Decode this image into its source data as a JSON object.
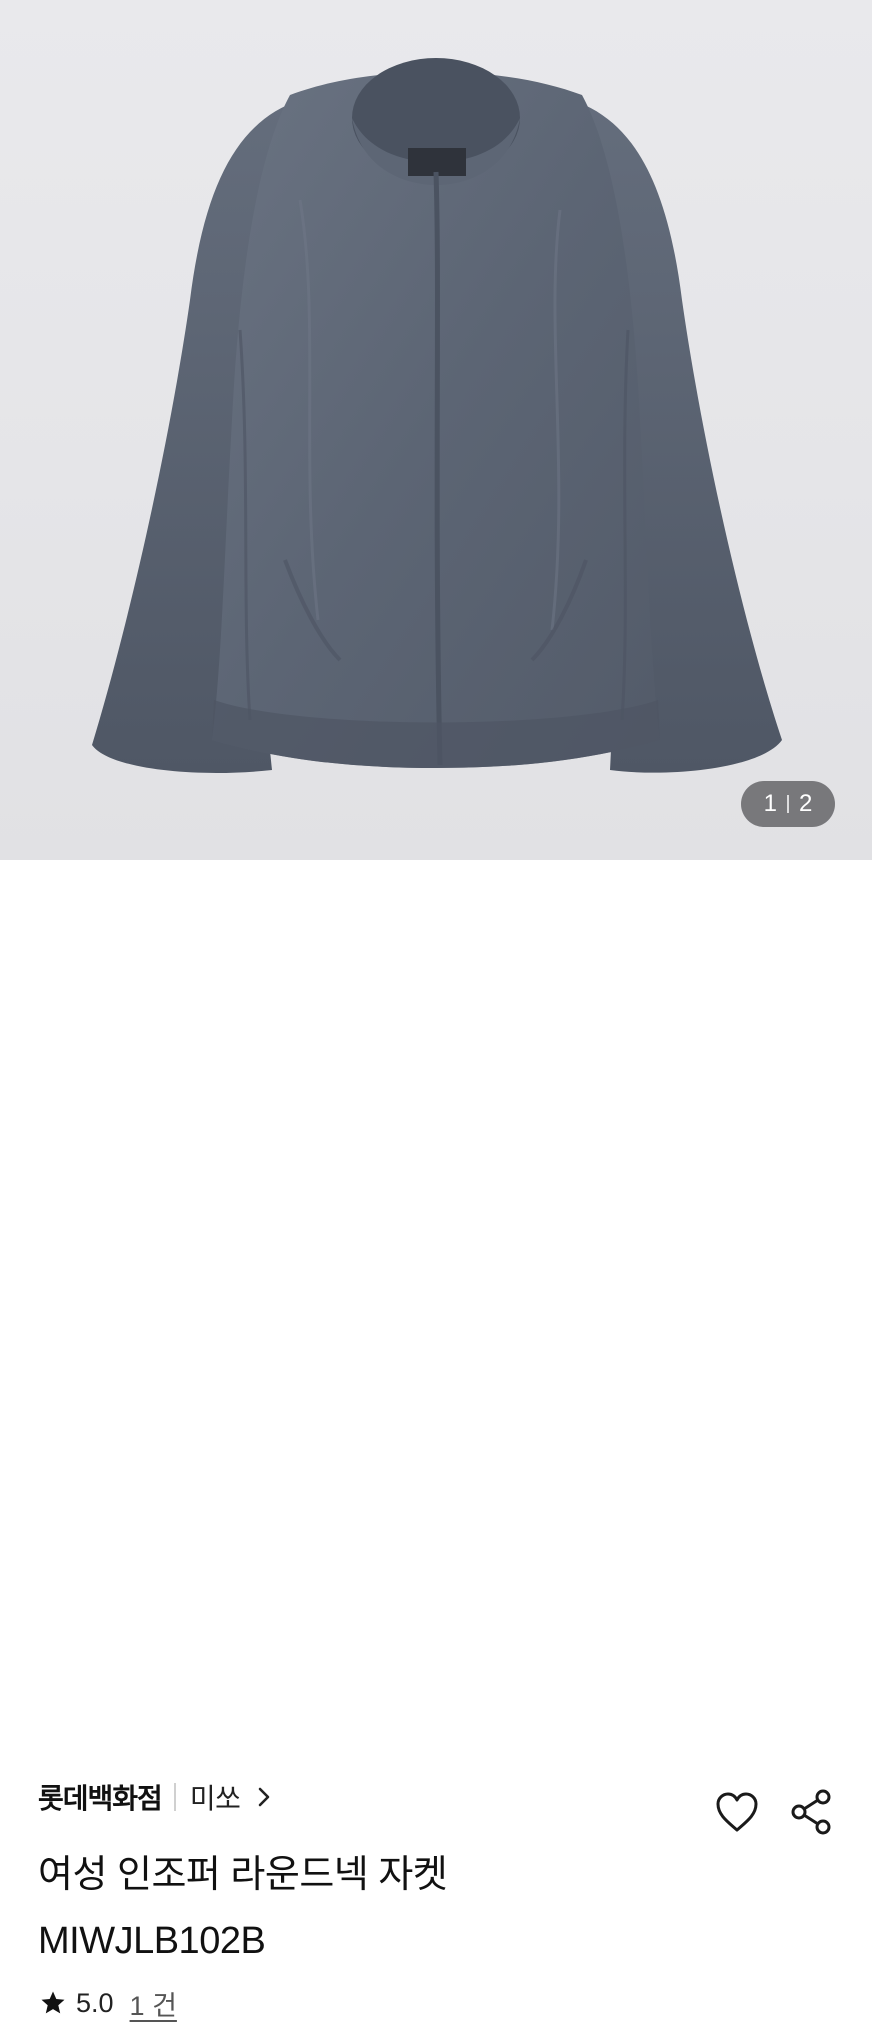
{
  "product_image": {
    "alt": "",
    "counter": {
      "current": "1",
      "total": "2"
    }
  },
  "product": {
    "brand": "롯데백화점",
    "sub_brand": "미쏘",
    "title_line1": "여성 인조퍼 라운드넥 자켓",
    "title_line2": "MIWJLB102B",
    "rating": "5.0",
    "review_count": "1 건"
  },
  "icons": {
    "brand_link": "chevron-right-icon",
    "favorite": "heart-outline-icon",
    "share": "share-icon",
    "rating": "star-icon"
  },
  "colors": {
    "jacket": "#5d6675",
    "background": "#e6e6e9",
    "counter_bg": "#5a5a5e"
  }
}
